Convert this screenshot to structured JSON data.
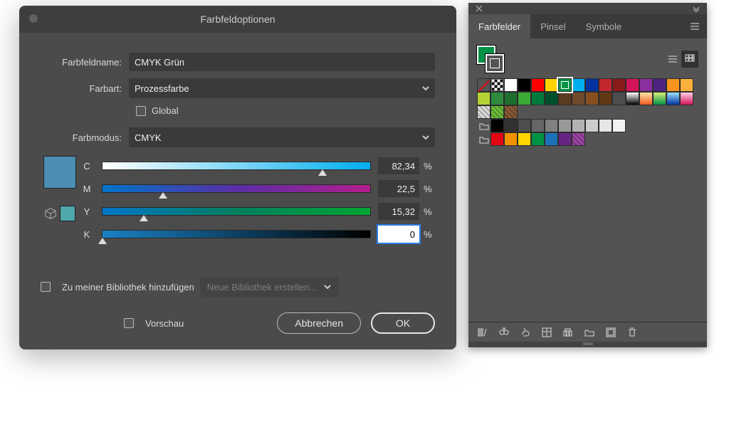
{
  "dialog": {
    "title": "Farbfeldoptionen",
    "fields": {
      "name_label": "Farbfeldname:",
      "name_value": "CMYK Grün",
      "type_label": "Farbart:",
      "type_value": "Prozessfarbe",
      "global_label": "Global",
      "mode_label": "Farbmodus:",
      "mode_value": "CMYK"
    },
    "swatch_preview": "#4a8eb1",
    "swatch_alt": "#4fa6ab",
    "cmyk": [
      {
        "ch": "C",
        "val": "82,34",
        "knob": 82.3,
        "grad": "gC",
        "focus": false
      },
      {
        "ch": "M",
        "val": "22,5",
        "knob": 22.5,
        "grad": "gM",
        "focus": false
      },
      {
        "ch": "Y",
        "val": "15,32",
        "knob": 15.3,
        "grad": "gY",
        "focus": false
      },
      {
        "ch": "K",
        "val": "0",
        "knob": 0,
        "grad": "gK",
        "focus": true
      }
    ],
    "pct": "%",
    "library": {
      "add_label": "Zu meiner Bibliothek hinzufügen",
      "select_label": "Neue Bibliothek erstellen..."
    },
    "footer": {
      "preview": "Vorschau",
      "cancel": "Abbrechen",
      "ok": "OK"
    }
  },
  "panel": {
    "tabs": [
      "Farbfelder",
      "Pinsel",
      "Symbole"
    ],
    "active_tab": 0,
    "fill_color": "#009245",
    "swatches": [
      [
        {
          "t": "none"
        },
        {
          "t": "reg"
        },
        {
          "c": "#ffffff"
        },
        {
          "c": "#000000"
        },
        {
          "c": "#ff0000"
        },
        {
          "c": "#ffd400"
        },
        {
          "c": "#009245",
          "sel": true
        },
        {
          "c": "#00adee"
        },
        {
          "c": "#0033a0"
        },
        {
          "c": "#c1272d"
        },
        {
          "c": "#8a1a1a"
        },
        {
          "c": "#d4145a"
        },
        {
          "c": "#8b2fa0"
        },
        {
          "c": "#4a2480"
        },
        {
          "c": "#f7931e"
        },
        {
          "c": "#fbb03b"
        }
      ],
      [
        {
          "c": "#b3d235"
        },
        {
          "c": "#2e8b3d"
        },
        {
          "c": "#1f6e2e"
        },
        {
          "c": "#3aaa35"
        },
        {
          "c": "#007a3d"
        },
        {
          "c": "#004f2d"
        },
        {
          "c": "#5a3b20"
        },
        {
          "c": "#6e4a2a"
        },
        {
          "c": "#874f1f"
        },
        {
          "c": "#603813"
        },
        {
          "c": "#4d4d4d"
        },
        {
          "c": "#d9d9d9",
          "grad": "linear-gradient(180deg,#fff,#000)"
        },
        {
          "c": "#f7931e",
          "grad": "linear-gradient(180deg,#fde7a4,#f15a24)"
        },
        {
          "c": "#7ac943",
          "grad": "linear-gradient(180deg,#d9ed7b,#009245)"
        },
        {
          "c": "#29abe2",
          "grad": "linear-gradient(180deg,#9be1ff,#0033a0)"
        },
        {
          "c": "#f06eaa",
          "grad": "linear-gradient(180deg,#ffd1e8,#d4145a)"
        }
      ],
      [
        {
          "c": "#dcdcdc",
          "pat": true
        },
        {
          "c": "#6bbf3b",
          "pat": true
        },
        {
          "c": "#8a5a36",
          "pat": true
        }
      ],
      [
        {
          "t": "folder"
        },
        {
          "c": "#000000"
        },
        {
          "c": "#323232"
        },
        {
          "c": "#4d4d4d"
        },
        {
          "c": "#666666"
        },
        {
          "c": "#808080"
        },
        {
          "c": "#999999"
        },
        {
          "c": "#b3b3b3"
        },
        {
          "c": "#cccccc"
        },
        {
          "c": "#e6e6e6"
        },
        {
          "c": "#f2f2f2"
        }
      ],
      [
        {
          "t": "folder"
        },
        {
          "c": "#e30613"
        },
        {
          "c": "#f39200"
        },
        {
          "c": "#ffd400"
        },
        {
          "c": "#009245"
        },
        {
          "c": "#1d71b8"
        },
        {
          "c": "#662483"
        },
        {
          "c": "#9e45a4",
          "pat": true
        }
      ]
    ]
  }
}
